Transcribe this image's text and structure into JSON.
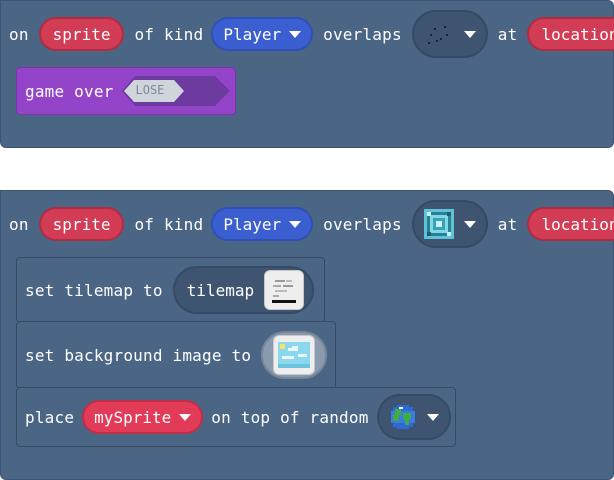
{
  "event1": {
    "on": "on",
    "sprite": "sprite",
    "of_kind": "of kind",
    "kind": "Player",
    "overlaps": "overlaps",
    "at": "at",
    "location": "location",
    "tile_icon": "empty-tile-icon",
    "body": {
      "game_over": "game over",
      "result": "LOSE"
    }
  },
  "event2": {
    "on": "on",
    "sprite": "sprite",
    "of_kind": "of kind",
    "kind": "Player",
    "overlaps": "overlaps",
    "at": "at",
    "location": "location",
    "tile_icon": "cyan-tile-icon",
    "statements": {
      "set_tilemap": "set tilemap to",
      "tilemap": "tilemap",
      "set_background": "set background image to",
      "place": "place",
      "my_sprite": "mySprite",
      "on_top_of_random": "on top of random",
      "random_icon": "globe-tile-icon"
    }
  },
  "colors": {
    "event_block": "#4b6585",
    "sprite_pill": "#d33c55",
    "kind_pill": "#3b5fd0",
    "game_block": "#9444c8",
    "lose_chevron": "#6d3aa0",
    "lose_text": "#8c98a6"
  }
}
